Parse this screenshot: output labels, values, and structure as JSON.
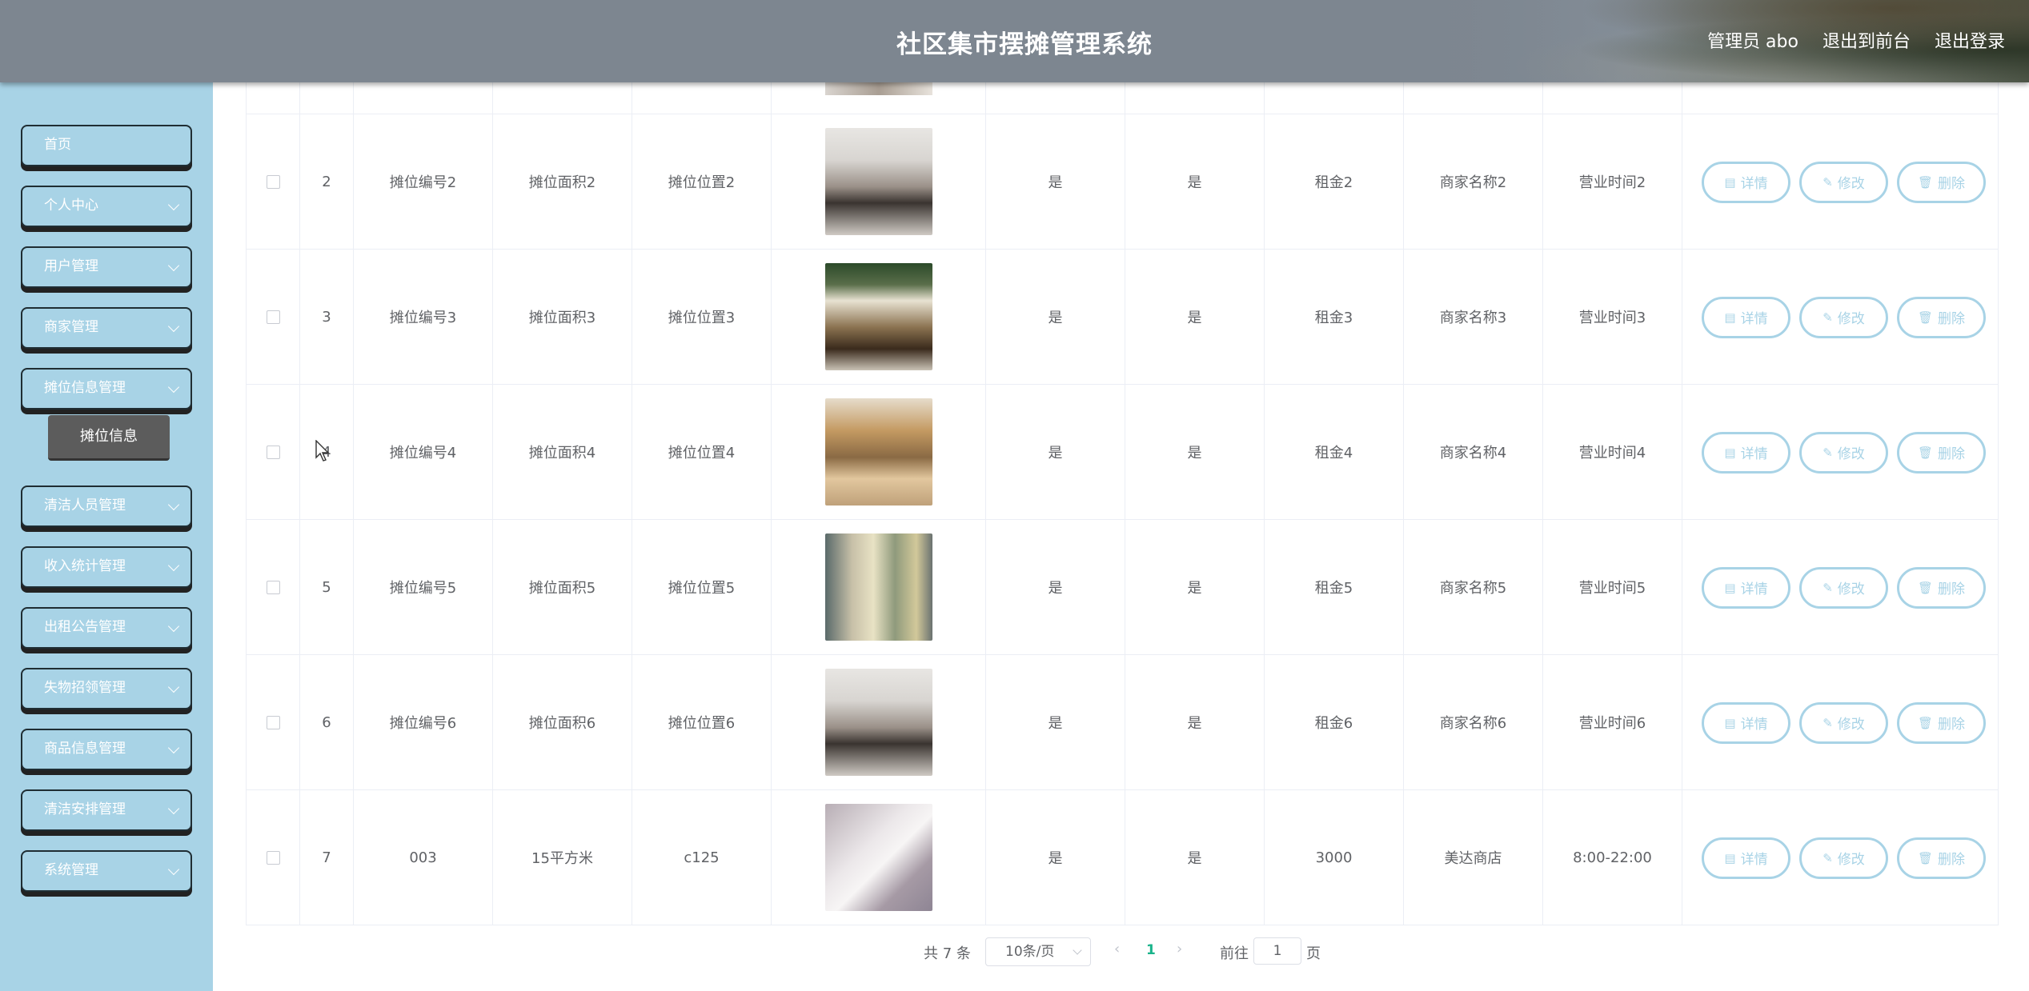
{
  "header": {
    "title": "社区集市摆摊管理系统",
    "user_label": "管理员 abo",
    "to_front_label": "退出到前台",
    "logout_label": "退出登录"
  },
  "sidebar": {
    "items": [
      {
        "label": "首页",
        "has_children": false
      },
      {
        "label": "个人中心",
        "has_children": true
      },
      {
        "label": "用户管理",
        "has_children": true
      },
      {
        "label": "商家管理",
        "has_children": true
      },
      {
        "label": "摊位信息管理",
        "has_children": true
      },
      {
        "label": "清洁人员管理",
        "has_children": true
      },
      {
        "label": "收入统计管理",
        "has_children": true
      },
      {
        "label": "出租公告管理",
        "has_children": true
      },
      {
        "label": "失物招领管理",
        "has_children": true
      },
      {
        "label": "商品信息管理",
        "has_children": true
      },
      {
        "label": "清洁安排管理",
        "has_children": true
      },
      {
        "label": "系统管理",
        "has_children": true
      }
    ],
    "active_submenu": "摊位信息"
  },
  "table": {
    "rows": [
      {
        "index": "2",
        "stall_no": "摊位编号2",
        "area": "摊位面积2",
        "location": "摊位位置2",
        "image": "store-interior-gray",
        "flag1": "是",
        "flag2": "是",
        "rent": "租金2",
        "merchant": "商家名称2",
        "hours": "营业时间2"
      },
      {
        "index": "3",
        "stall_no": "摊位编号3",
        "area": "摊位面积3",
        "location": "摊位位置3",
        "image": "shop-front-green",
        "flag1": "是",
        "flag2": "是",
        "rent": "租金3",
        "merchant": "商家名称3",
        "hours": "营业时间3"
      },
      {
        "index": "4",
        "stall_no": "摊位编号4",
        "area": "摊位面积4",
        "location": "摊位位置4",
        "image": "bookstore-wood",
        "flag1": "是",
        "flag2": "是",
        "rent": "租金4",
        "merchant": "商家名称4",
        "hours": "营业时间4"
      },
      {
        "index": "5",
        "stall_no": "摊位编号5",
        "area": "摊位面积5",
        "location": "摊位位置5",
        "image": "grocery-shelves",
        "flag1": "是",
        "flag2": "是",
        "rent": "租金5",
        "merchant": "商家名称5",
        "hours": "营业时间5"
      },
      {
        "index": "6",
        "stall_no": "摊位编号6",
        "area": "摊位面积6",
        "location": "摊位位置6",
        "image": "store-interior-gray",
        "flag1": "是",
        "flag2": "是",
        "rent": "租金6",
        "merchant": "商家名称6",
        "hours": "营业时间6"
      },
      {
        "index": "7",
        "stall_no": "003",
        "area": "15平方米",
        "location": "c125",
        "image": "paper-fold",
        "flag1": "是",
        "flag2": "是",
        "rent": "3000",
        "merchant": "美达商店",
        "hours": "8:00-22:00"
      }
    ],
    "actions": {
      "detail_label": "详情",
      "edit_label": "修改",
      "delete_label": "删除"
    }
  },
  "pagination": {
    "total_label": "共 7 条",
    "page_size_label": "10条/页",
    "current_page": "1",
    "goto_label": "前往",
    "goto_value": "1",
    "goto_suffix": "页"
  },
  "colors": {
    "accent": "#a8d3e6",
    "header_bg": "#7d8690",
    "active_page": "#19b38a"
  }
}
